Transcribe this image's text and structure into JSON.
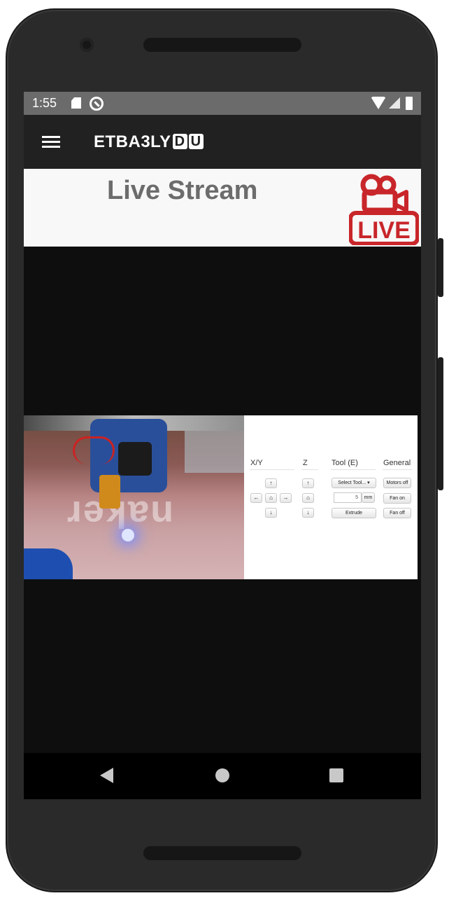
{
  "status_bar": {
    "time": "1:55"
  },
  "app_bar": {
    "title": "ETBA3LY",
    "title_box_1": "D",
    "title_box_2": "U"
  },
  "header": {
    "title": "Live Stream",
    "live_badge_text": "LIVE"
  },
  "control_panel": {
    "columns": [
      "X/Y",
      "Z",
      "Tool (E)",
      "General"
    ],
    "tool_select_label": "Select Tool...",
    "extrude_amount": "5",
    "extrude_unit": "mm",
    "extrude_button": "Extrude",
    "motors_off_button": "Motors off",
    "fan_on_button": "Fan on",
    "fan_off_button": "Fan off"
  },
  "colors": {
    "accent_red": "#c8262a",
    "app_bar_bg": "#212121",
    "status_bar_bg": "#6b6b6b"
  },
  "icons": [
    "menu-icon",
    "sd-card-icon",
    "sync-icon",
    "wifi-icon",
    "signal-icon",
    "battery-icon",
    "video-camera-icon",
    "back-icon",
    "home-icon",
    "recents-icon"
  ]
}
